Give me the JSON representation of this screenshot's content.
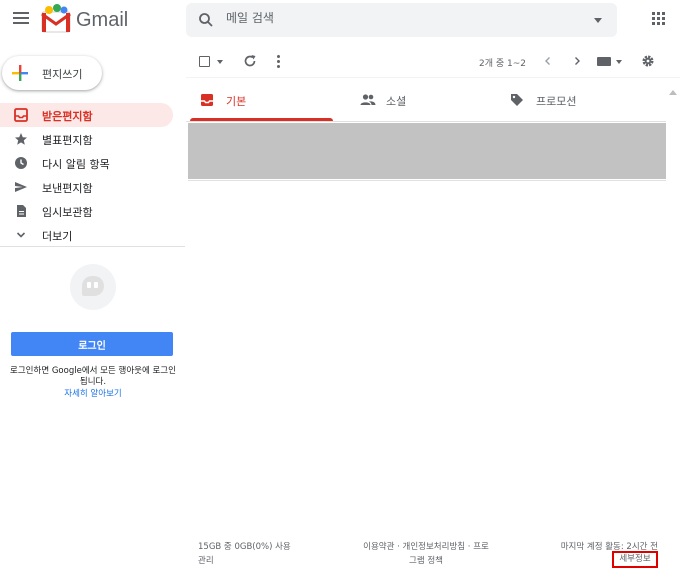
{
  "header": {
    "app_name": "Gmail",
    "search_placeholder": "메일 검색"
  },
  "sidebar": {
    "compose_label": "편지쓰기",
    "items": [
      {
        "label": "받은편지함",
        "icon": "inbox-icon",
        "active": true
      },
      {
        "label": "별표편지함",
        "icon": "star-icon",
        "active": false
      },
      {
        "label": "다시 알림 항목",
        "icon": "clock-icon",
        "active": false
      },
      {
        "label": "보낸편지함",
        "icon": "send-icon",
        "active": false
      },
      {
        "label": "임시보관함",
        "icon": "draft-icon",
        "active": false
      },
      {
        "label": "더보기",
        "icon": "chevron-down-icon",
        "active": false
      }
    ],
    "hangouts": {
      "login_button": "로그인",
      "description": "로그인하면 Google에서 모든 행아웃에 로그인됩니다.",
      "learn_more": "자세히 알아보기"
    }
  },
  "toolbar": {
    "count_text": "2개 중 1~2"
  },
  "tabs": [
    {
      "label": "기본",
      "icon": "inbox-icon",
      "active": true
    },
    {
      "label": "소셜",
      "icon": "people-icon",
      "active": false
    },
    {
      "label": "프로모션",
      "icon": "tag-icon",
      "active": false
    }
  ],
  "footer": {
    "storage_line1": "15GB 중 0GB(0%) 사용",
    "storage_line2": "관리",
    "terms_line1": "이용약관 · 개인정보처리방침 · 프로",
    "terms_line2": "그램 정책",
    "activity": "마지막 계정 활동: 2시간 전",
    "details": "세부정보"
  },
  "colors": {
    "accent_red": "#d93025",
    "active_bg": "#fce8e6",
    "login_blue": "#4285f4",
    "highlight_box": "#e00000"
  }
}
